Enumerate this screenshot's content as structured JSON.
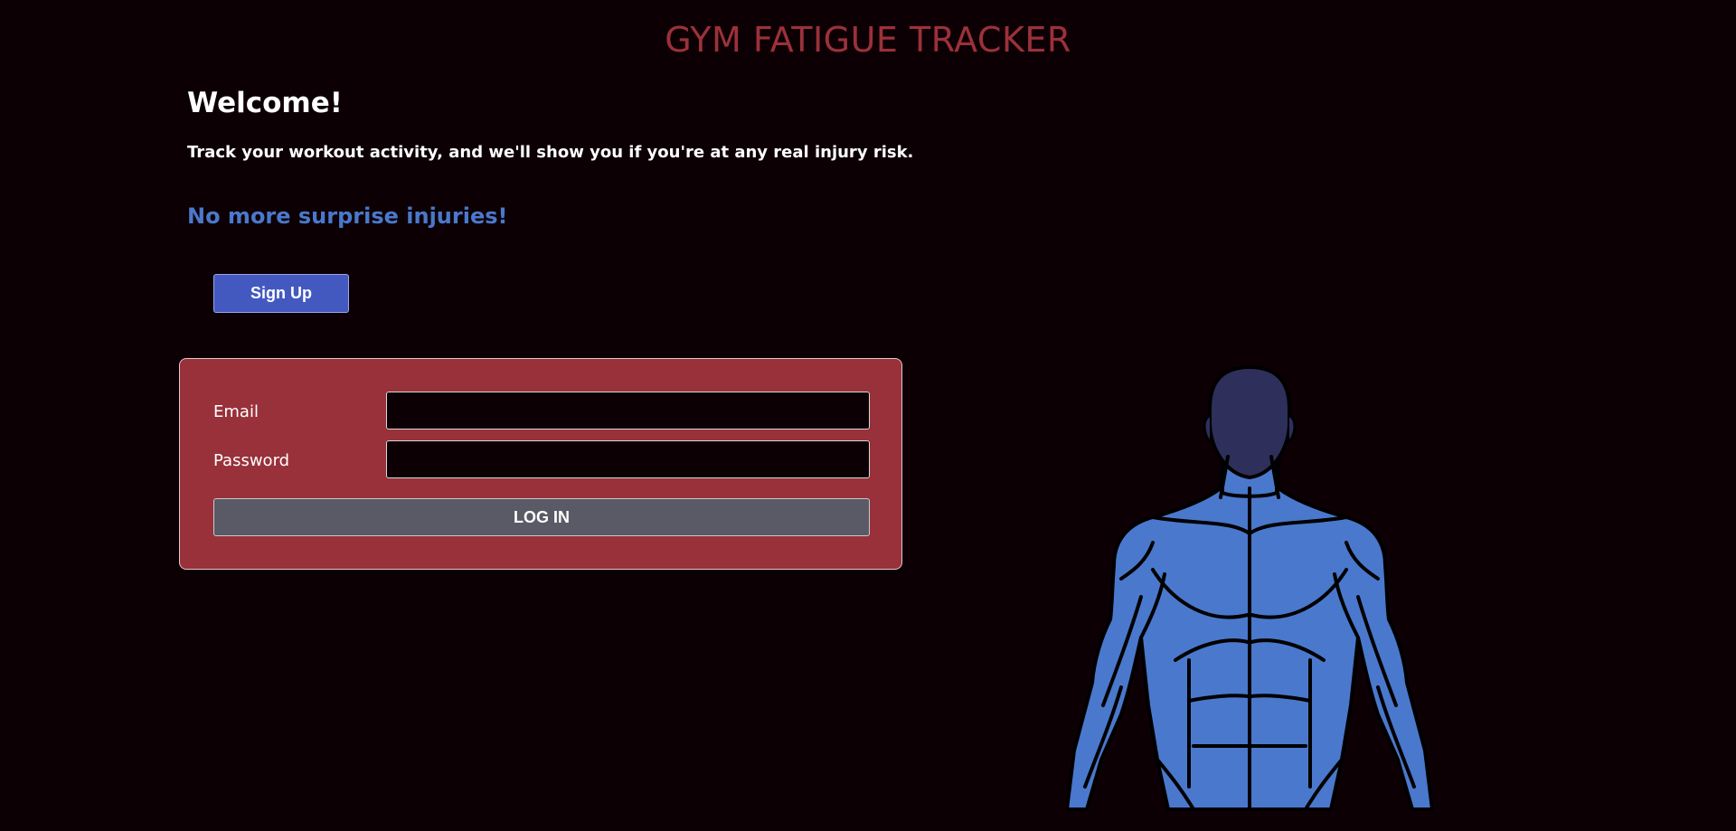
{
  "header": {
    "title": "GYM FATIGUE TRACKER"
  },
  "intro": {
    "welcome": "Welcome!",
    "tagline": "Track your workout activity, and we'll show you if you're at any real injury risk.",
    "slogan": "No more surprise injuries!"
  },
  "signup": {
    "label": "Sign Up"
  },
  "login": {
    "email_label": "Email",
    "email_value": "",
    "password_label": "Password",
    "password_value": "",
    "button_label": "LOG IN"
  },
  "illustration": {
    "icon": "muscle-body-illustration",
    "body_color": "#4a78cc",
    "head_color": "#2e2f5a"
  },
  "colors": {
    "background": "#0d0005",
    "title": "#9b313a",
    "accent": "#4a78cc",
    "panel": "#98313a",
    "signup": "#4459c0",
    "login_button": "#5a5a66"
  }
}
